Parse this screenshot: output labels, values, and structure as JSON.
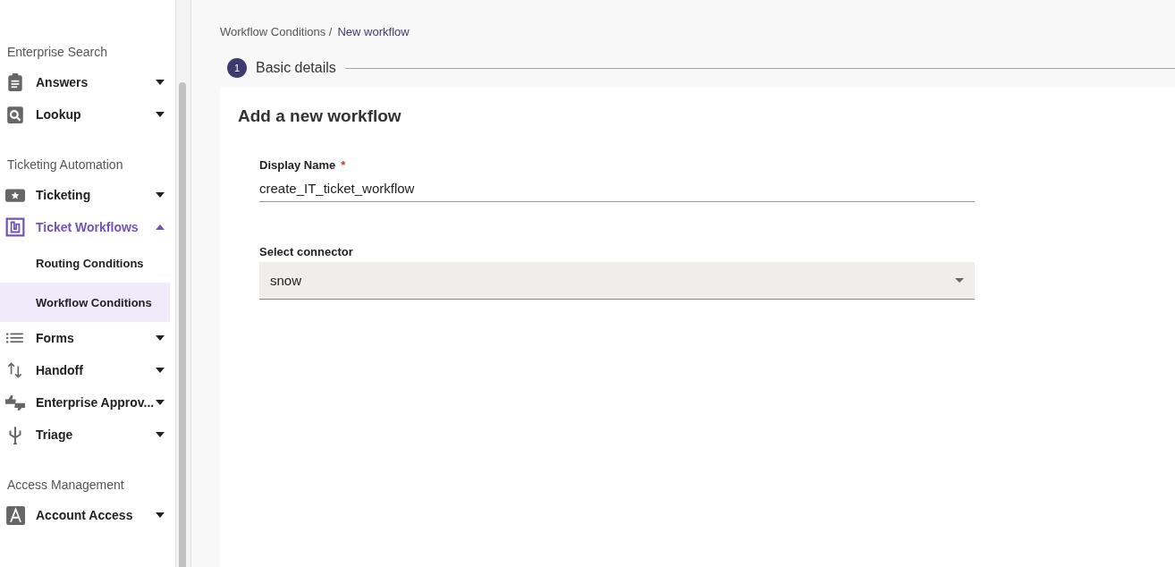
{
  "sidebar": {
    "sections": [
      {
        "heading": "Enterprise Search",
        "items": [
          {
            "label": "Answers",
            "expanded": false,
            "selected": false
          },
          {
            "label": "Lookup",
            "expanded": false,
            "selected": false
          }
        ]
      },
      {
        "heading": "Ticketing Automation",
        "items": [
          {
            "label": "Ticketing",
            "expanded": false,
            "selected": false
          },
          {
            "label": "Ticket Workflows",
            "expanded": true,
            "selected": true,
            "children": [
              {
                "label": "Routing Conditions",
                "selected": false
              },
              {
                "label": "Workflow Conditions",
                "selected": true
              }
            ]
          },
          {
            "label": "Forms",
            "expanded": false,
            "selected": false
          },
          {
            "label": "Handoff",
            "expanded": false,
            "selected": false
          },
          {
            "label": "Enterprise Approv...",
            "expanded": false,
            "selected": false
          },
          {
            "label": "Triage",
            "expanded": false,
            "selected": false
          }
        ]
      },
      {
        "heading": "Access Management",
        "items": [
          {
            "label": "Account Access",
            "expanded": false,
            "selected": false
          }
        ]
      }
    ]
  },
  "breadcrumb": [
    "Workflow Conditions /",
    "New workflow"
  ],
  "stepper": [
    {
      "number": "1",
      "label": "Basic details"
    }
  ],
  "form": {
    "title": "Add a new workflow",
    "fields": [
      {
        "kind": "text",
        "label": "Display Name",
        "required_mark": "*",
        "value": "create_IT_ticket_workflow"
      },
      {
        "kind": "select",
        "label": "Select connector",
        "value": "snow"
      }
    ]
  }
}
